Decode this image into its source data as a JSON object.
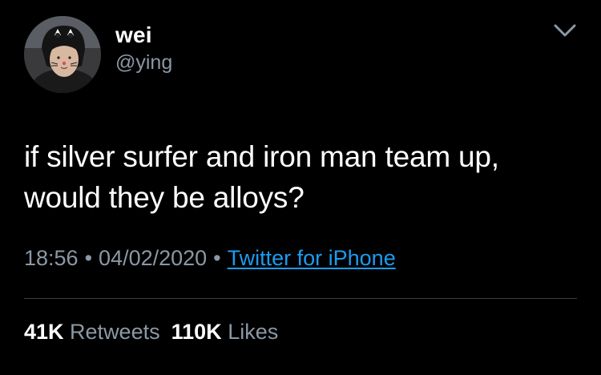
{
  "user": {
    "display_name": "wei",
    "handle": "@ying",
    "avatar_icon": "user-avatar"
  },
  "tweet": {
    "text_line1": "if silver surfer and iron man team up,",
    "text_line2": "would they be alloys?"
  },
  "meta": {
    "time": "18:56",
    "separator": "•",
    "date": "04/02/2020",
    "source": "Twitter for iPhone"
  },
  "stats": {
    "retweets_count": "41K",
    "retweets_label": "Retweets",
    "likes_count": "110K",
    "likes_label": "Likes"
  },
  "colors": {
    "background": "#000000",
    "secondary_text": "#8b98a5",
    "link": "#1d9bf0"
  },
  "icons": {
    "menu": "chevron-down-icon"
  }
}
